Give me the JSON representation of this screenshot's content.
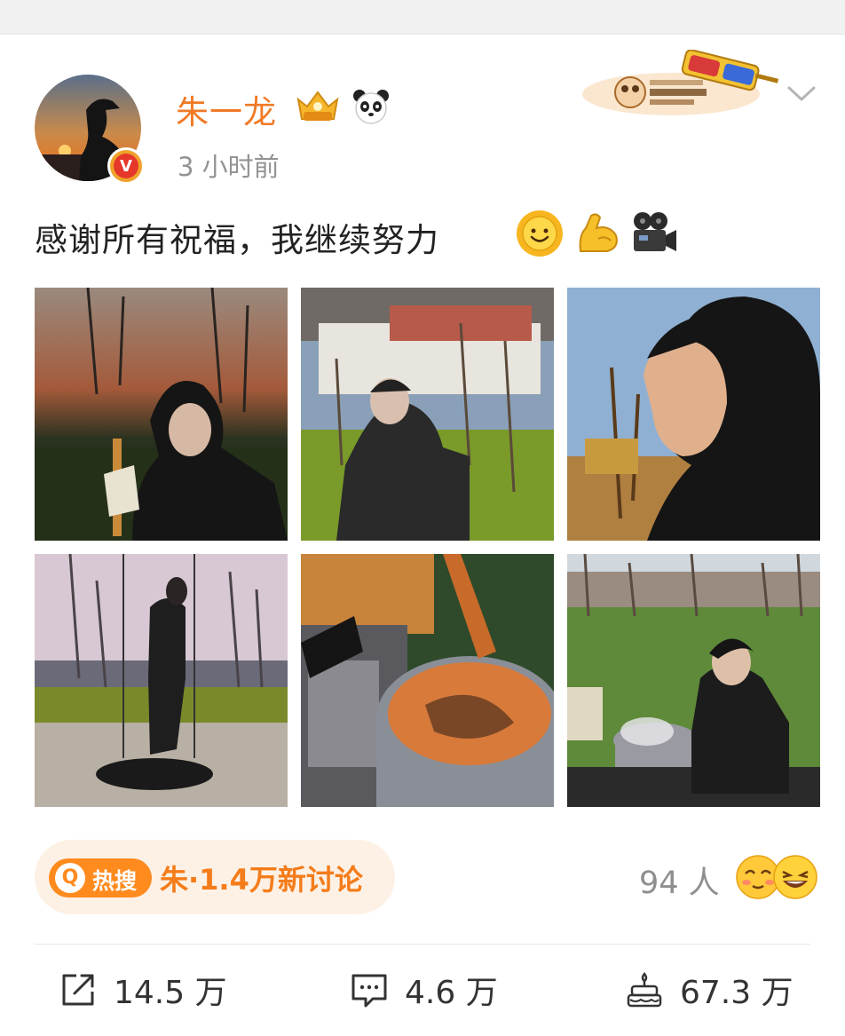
{
  "user": {
    "name": "朱一龙",
    "time": "3 小时前",
    "verified_mark": "V"
  },
  "post": {
    "text": "感谢所有祝福，我继续努力"
  },
  "hot_search": {
    "badge_q": "Q",
    "badge_label": "热搜",
    "topic": "朱·1.4万新讨论"
  },
  "reactions": {
    "people": "94 人"
  },
  "actions": {
    "share": "14.5 万",
    "comment": "4.6 万",
    "like": "67.3 万"
  },
  "colors": {
    "username": "#f07a26",
    "hot_badge": "#ff8a1e",
    "hot_pill": "#fdf1e5",
    "muted_text": "#939393"
  },
  "icons": [
    "vip-crown-icon",
    "panda-icon",
    "chevron-down-icon",
    "sun-face-emoji",
    "muscle-emoji",
    "movie-camera-emoji",
    "share-icon",
    "comment-icon",
    "birthday-cake-icon"
  ]
}
